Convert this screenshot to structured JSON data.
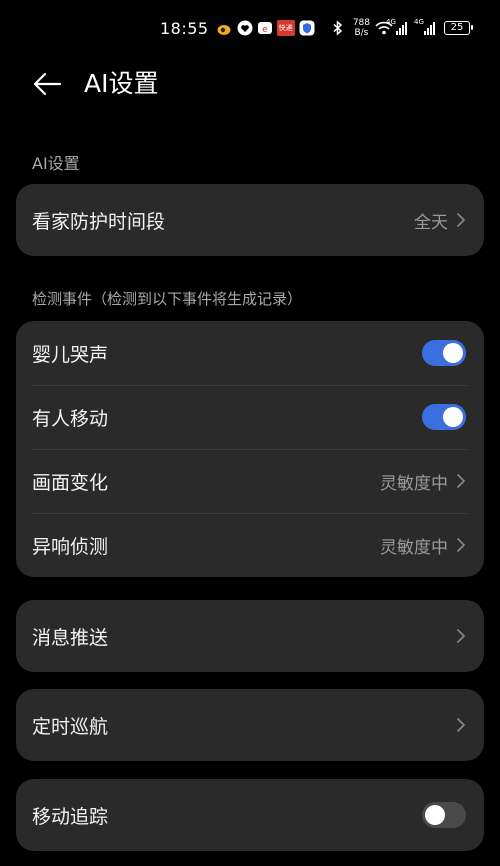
{
  "status_bar": {
    "time": "18:55",
    "net_speed_value": "788",
    "net_speed_unit": "B/s",
    "signal_1_type": "4G",
    "signal_2_type": "4G",
    "battery_level": "25",
    "app_badge_text": "快递"
  },
  "header": {
    "title": "AI设置"
  },
  "sections": {
    "ai_settings_label": "AI设置",
    "detect_events_label": "检测事件（检测到以下事件将生成记录）"
  },
  "home_guard": {
    "label": "看家防护时间段",
    "value": "全天"
  },
  "events": {
    "baby_cry": {
      "label": "婴儿哭声",
      "state": "on"
    },
    "person_move": {
      "label": "有人移动",
      "state": "on"
    },
    "picture_change": {
      "label": "画面变化",
      "value": "灵敏度中"
    },
    "abnormal_sound": {
      "label": "异响侦测",
      "value": "灵敏度中"
    }
  },
  "push": {
    "label": "消息推送"
  },
  "cruise": {
    "label": "定时巡航"
  },
  "tracking": {
    "label": "移动追踪",
    "state": "off"
  },
  "colors": {
    "background": "#000000",
    "card": "#2a2a2a",
    "accent": "#3b6fe0",
    "secondary_text": "#9a9a9a"
  }
}
